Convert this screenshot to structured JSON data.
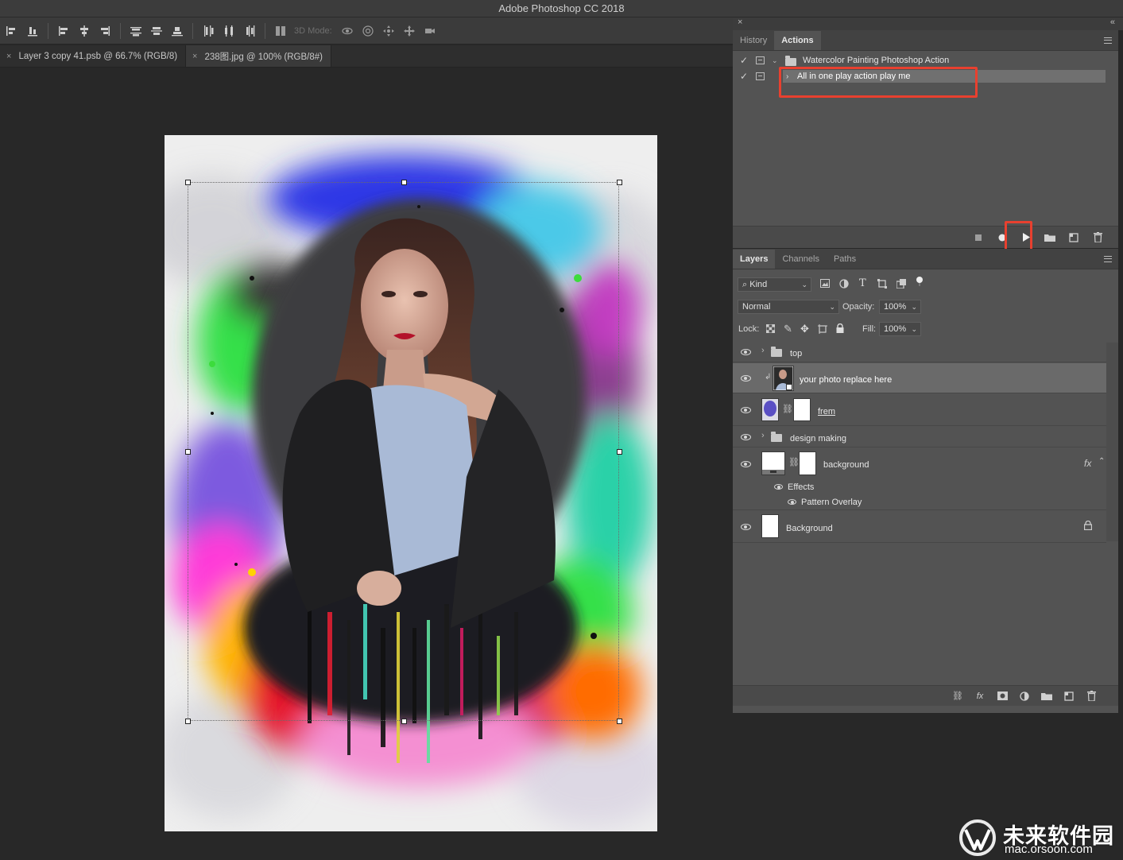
{
  "app": {
    "title": "Adobe Photoshop CC 2018"
  },
  "options_bar": {
    "mode_label": "3D Mode:"
  },
  "document_tabs": [
    {
      "label": "Layer 3 copy 41.psb @ 66.7% (RGB/8)",
      "close": "×"
    },
    {
      "label": "238图.jpg @ 100% (RGB/8#)",
      "close": "×"
    }
  ],
  "actions_panel": {
    "close_glyph": "×",
    "collapse_glyph": "«",
    "tabs": [
      {
        "label": "History",
        "active": false
      },
      {
        "label": "Actions",
        "active": true
      }
    ],
    "rows": [
      {
        "label": "Watercolor Painting Photoshop Action",
        "type": "set",
        "expanded": true,
        "checked": true
      },
      {
        "label": "All in one play action play me",
        "type": "action",
        "expanded": false,
        "checked": true,
        "selected": true
      }
    ],
    "footer_buttons": [
      "stop-icon",
      "record-icon",
      "play-icon",
      "new-set-icon",
      "new-action-icon",
      "delete-icon"
    ],
    "highlight_color": "#e8402f"
  },
  "layers_panel": {
    "tabs": [
      {
        "label": "Layers",
        "active": true
      },
      {
        "label": "Channels",
        "active": false
      },
      {
        "label": "Paths",
        "active": false
      }
    ],
    "filter": {
      "kind_label": "Kind"
    },
    "blend_mode": "Normal",
    "opacity_label": "Opacity:",
    "opacity_value": "100%",
    "lock_label": "Lock:",
    "fill_label": "Fill:",
    "fill_value": "100%",
    "layers": [
      {
        "name": "top",
        "type": "group"
      },
      {
        "name": "your photo replace here",
        "type": "smart",
        "selected": true
      },
      {
        "name": "frem",
        "type": "masked"
      },
      {
        "name": "design making",
        "type": "group"
      },
      {
        "name": "background",
        "type": "masked-fx",
        "fx_label": "fx"
      },
      {
        "name": "Effects",
        "type": "effects"
      },
      {
        "name": "Pattern Overlay",
        "type": "effect"
      },
      {
        "name": "Background",
        "type": "locked"
      }
    ]
  },
  "watermark": {
    "cn": "未来软件园",
    "url": "mac.orsoon.com"
  }
}
